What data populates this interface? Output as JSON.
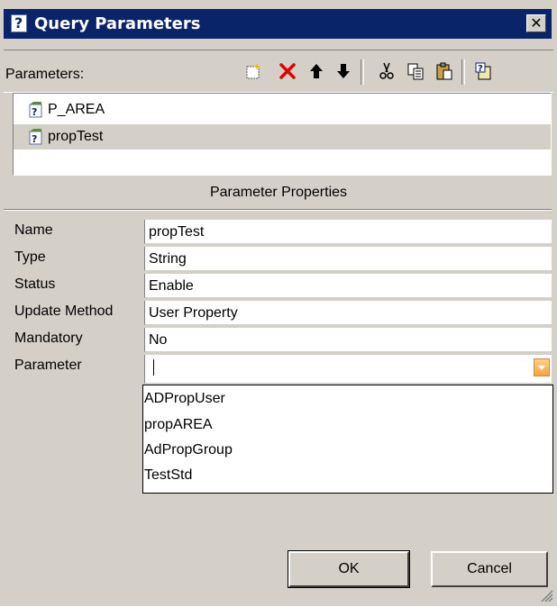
{
  "window": {
    "title": "Query Parameters",
    "close_glyph": "✕"
  },
  "toolbar": {
    "label": "Parameters:",
    "icons": [
      "new-parameter-icon",
      "delete-icon",
      "move-up-icon",
      "move-down-icon",
      "cut-icon",
      "copy-icon",
      "paste-icon",
      "properties-icon"
    ]
  },
  "parameters": [
    {
      "name": "P_AREA",
      "selected": false
    },
    {
      "name": "propTest",
      "selected": true
    }
  ],
  "properties": {
    "section_title": "Parameter Properties",
    "rows": [
      {
        "label": "Name",
        "value": "propTest"
      },
      {
        "label": "Type",
        "value": "String"
      },
      {
        "label": "Status",
        "value": "Enable"
      },
      {
        "label": "Update Method",
        "value": "User Property"
      },
      {
        "label": "Mandatory",
        "value": "No"
      },
      {
        "label": "Parameter",
        "value": ""
      }
    ]
  },
  "dropdown": {
    "options": [
      "ADPropUser",
      "propAREA",
      "AdPropGroup",
      "TestStd"
    ]
  },
  "buttons": {
    "ok": "OK",
    "cancel": "Cancel"
  },
  "colors": {
    "title_bar": "#0a246a",
    "dialog_bg": "#d4d0c8",
    "delete_red": "#e00000",
    "dropdown_button": "#f5a440"
  }
}
